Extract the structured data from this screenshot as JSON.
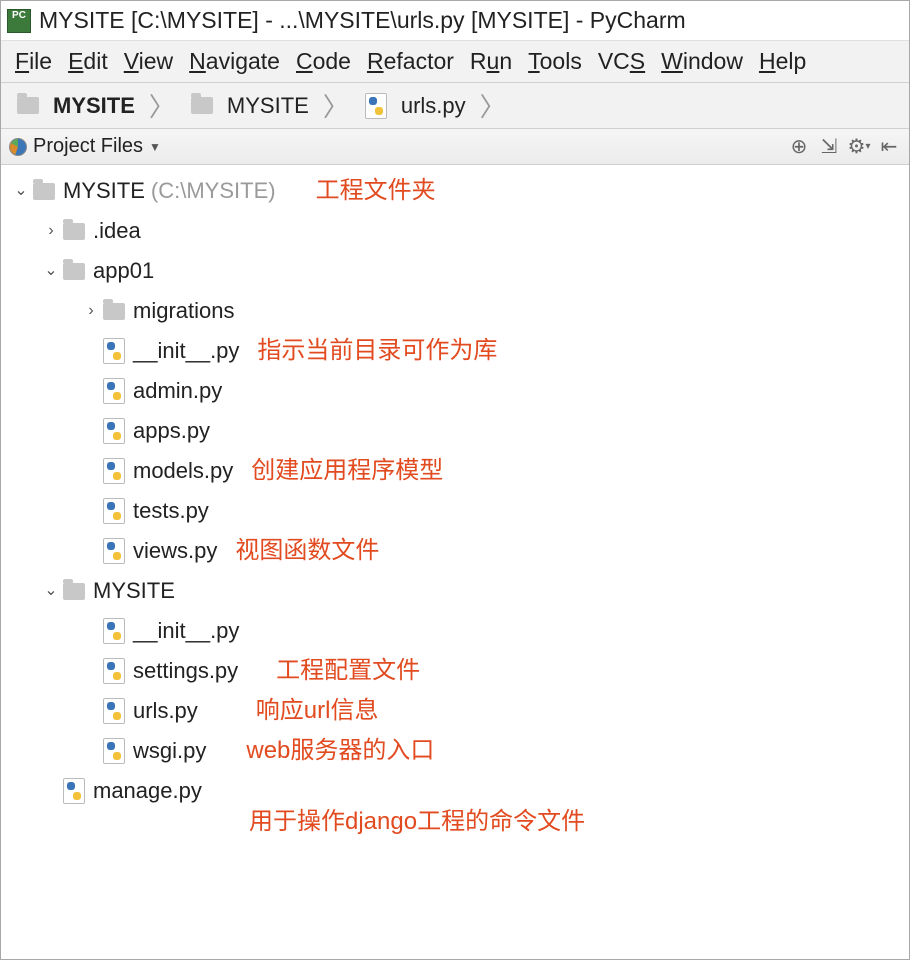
{
  "window": {
    "title": "MYSITE [C:\\MYSITE] - ...\\MYSITE\\urls.py [MYSITE] - PyCharm"
  },
  "menu": {
    "file": "File",
    "edit": "Edit",
    "view": "View",
    "navigate": "Navigate",
    "code": "Code",
    "refactor": "Refactor",
    "run": "Run",
    "tools": "Tools",
    "vcs": "VCS",
    "window": "Window",
    "help": "Help"
  },
  "breadcrumb": {
    "root": "MYSITE",
    "dir": "MYSITE",
    "file": "urls.py"
  },
  "panel": {
    "title": "Project Files"
  },
  "tree": {
    "root": {
      "name": "MYSITE",
      "path": "(C:\\MYSITE)"
    },
    "idea": ".idea",
    "app01": "app01",
    "migrations": "migrations",
    "app_init": "__init__.py",
    "admin": "admin.py",
    "apps": "apps.py",
    "models": "models.py",
    "tests": "tests.py",
    "views": "views.py",
    "mysite_dir": "MYSITE",
    "mysite_init": "__init__.py",
    "settings": "settings.py",
    "urls": "urls.py",
    "wsgi": "wsgi.py",
    "manage": "manage.py"
  },
  "annotations": {
    "project_folder": "工程文件夹",
    "init_lib": "指示当前目录可作为库",
    "models": "创建应用程序模型",
    "views": "视图函数文件",
    "settings": "工程配置文件",
    "urls": "响应url信息",
    "wsgi": "web服务器的入口",
    "manage": "用于操作django工程的命令文件"
  }
}
